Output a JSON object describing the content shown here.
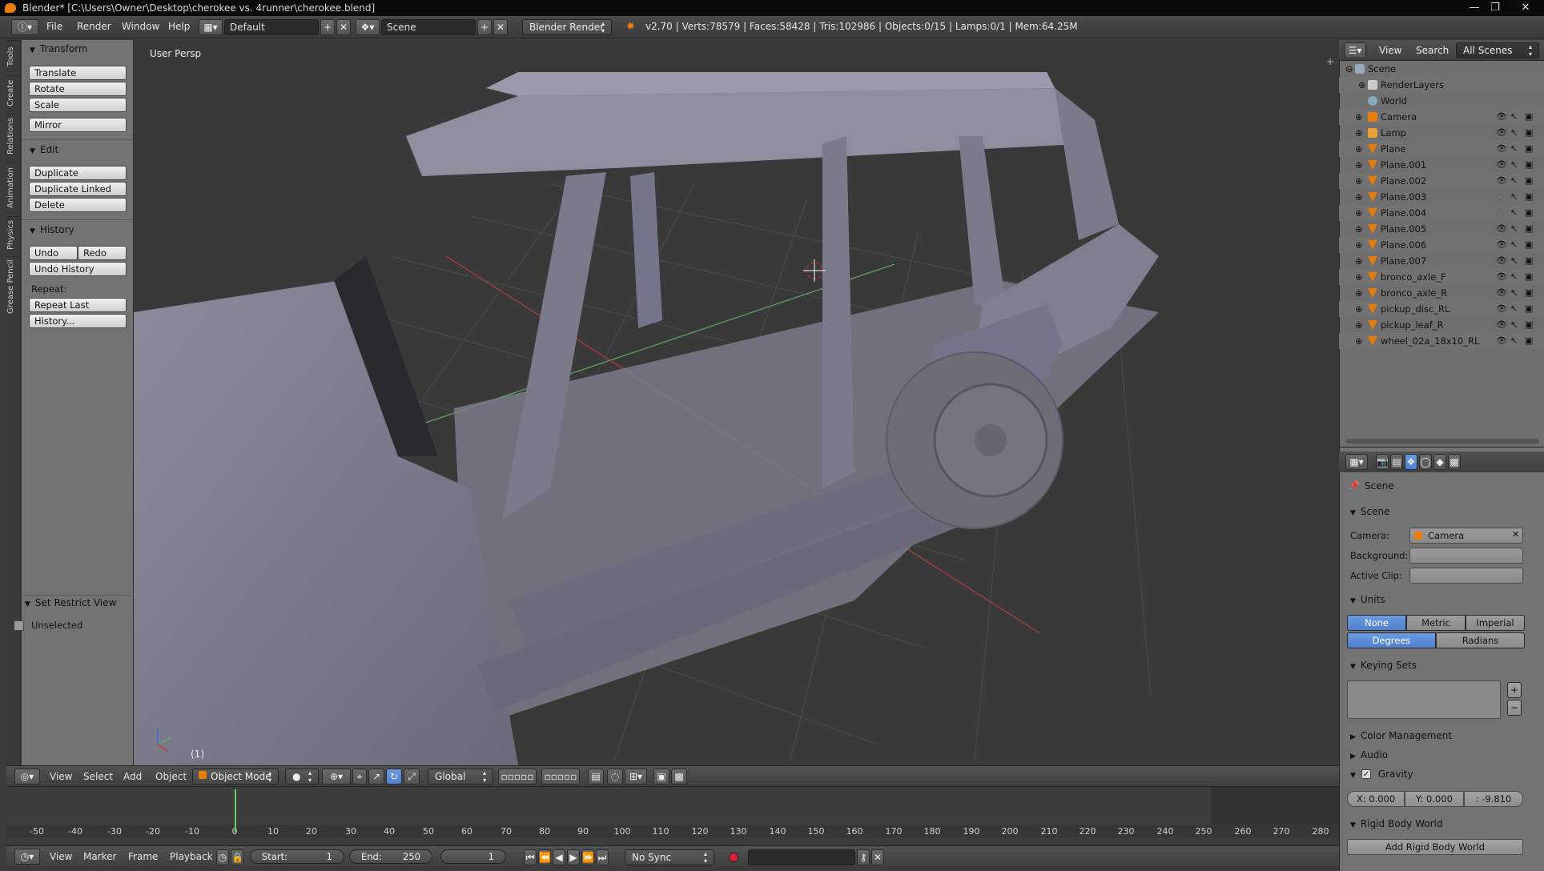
{
  "window": {
    "title": "Blender* [C:\\Users\\Owner\\Desktop\\cherokee vs. 4runner\\cherokee.blend]",
    "controls": [
      "—",
      "❐",
      "✕"
    ]
  },
  "info_header": {
    "menus": [
      "File",
      "Render",
      "Window",
      "Help"
    ],
    "screen_layout": "Default",
    "scene": "Scene",
    "render_engine": "Blender Render",
    "stats": "v2.70 | Verts:78579 | Faces:58428 | Tris:102986 | Objects:0/15 | Lamps:0/1 | Mem:64.25M"
  },
  "tool_shelf": {
    "vertical_tabs": [
      "Tools",
      "Create",
      "Relations",
      "Animation",
      "Physics",
      "Grease Pencil"
    ],
    "transform": {
      "title": "Transform",
      "buttons": [
        "Translate",
        "Rotate",
        "Scale",
        "Mirror"
      ]
    },
    "edit": {
      "title": "Edit",
      "buttons": [
        "Duplicate",
        "Duplicate Linked",
        "Delete"
      ]
    },
    "history": {
      "title": "History",
      "undo": "Undo",
      "redo": "Redo",
      "undo_history": "Undo History",
      "repeat_label": "Repeat:",
      "repeat_last": "Repeat Last",
      "history_btn": "History..."
    },
    "restrict": {
      "title": "Set Restrict View",
      "checkbox_label": "Unselected"
    }
  },
  "viewport": {
    "label": "User Persp",
    "frame_indicator": "(1)"
  },
  "view3d_header": {
    "menus": [
      "View",
      "Select",
      "Add",
      "Object"
    ],
    "mode": "Object Mode",
    "orientation": "Global"
  },
  "timeline": {
    "ticks": [
      "-50",
      "-40",
      "-30",
      "-20",
      "-10",
      "0",
      "10",
      "20",
      "30",
      "40",
      "50",
      "60",
      "70",
      "80",
      "90",
      "100",
      "110",
      "120",
      "130",
      "140",
      "150",
      "160",
      "170",
      "180",
      "190",
      "200",
      "210",
      "220",
      "230",
      "240",
      "250",
      "260",
      "270",
      "280"
    ],
    "menus": [
      "View",
      "Marker",
      "Frame",
      "Playback"
    ],
    "start_label": "Start:",
    "start": "1",
    "end_label": "End:",
    "end": "250",
    "current": "1",
    "sync": "No Sync"
  },
  "outliner": {
    "header": {
      "view": "View",
      "search": "Search",
      "filter": "All Scenes"
    },
    "rows": [
      {
        "name": "Scene",
        "kind": "scene"
      },
      {
        "name": "RenderLayers",
        "kind": "renderlayers"
      },
      {
        "name": "World",
        "kind": "world"
      },
      {
        "name": "Camera",
        "kind": "camera"
      },
      {
        "name": "Lamp",
        "kind": "lamp"
      },
      {
        "name": "Plane",
        "kind": "mesh"
      },
      {
        "name": "Plane.001",
        "kind": "mesh"
      },
      {
        "name": "Plane.002",
        "kind": "mesh"
      },
      {
        "name": "Plane.003",
        "kind": "mesh"
      },
      {
        "name": "Plane.004",
        "kind": "mesh"
      },
      {
        "name": "Plane.005",
        "kind": "mesh"
      },
      {
        "name": "Plane.006",
        "kind": "mesh"
      },
      {
        "name": "Plane.007",
        "kind": "mesh"
      },
      {
        "name": "bronco_axle_F",
        "kind": "mesh"
      },
      {
        "name": "bronco_axle_R",
        "kind": "mesh"
      },
      {
        "name": "pickup_disc_RL",
        "kind": "mesh"
      },
      {
        "name": "pickup_leaf_R",
        "kind": "mesh"
      },
      {
        "name": "wheel_02a_18x10_RL",
        "kind": "mesh"
      }
    ]
  },
  "properties": {
    "context": "Scene",
    "scene_panel": {
      "title": "Scene",
      "camera_label": "Camera:",
      "camera_value": "Camera",
      "background_label": "Background:",
      "clip_label": "Active Clip:"
    },
    "units": {
      "title": "Units",
      "systems": [
        "None",
        "Metric",
        "Imperial"
      ],
      "rotation": [
        "Degrees",
        "Radians"
      ]
    },
    "keying_sets": {
      "title": "Keying Sets"
    },
    "color_management": {
      "title": "Color Management"
    },
    "audio": {
      "title": "Audio"
    },
    "gravity": {
      "title": "Gravity",
      "x": "X: 0.000",
      "y": "Y: 0.000",
      "z": ": -9.810"
    },
    "rigid_body": {
      "title": "Rigid Body World",
      "button": "Add Rigid Body World"
    }
  },
  "colors": {
    "accent_blue": "#5680c2",
    "blender_orange": "#e87d0d",
    "playhead_green": "#5fd25f"
  }
}
